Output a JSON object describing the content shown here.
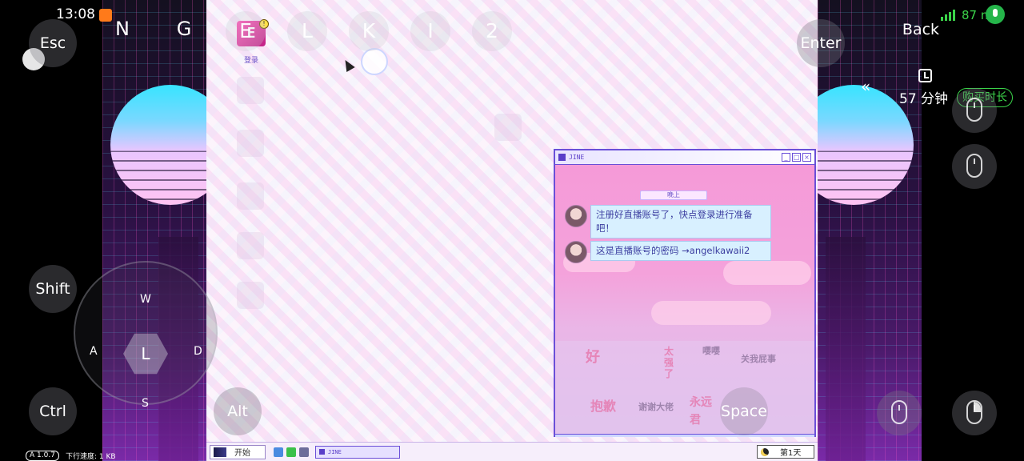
{
  "status_bar": {
    "time": "13:08",
    "battery": "87",
    "battery_suffix": "m"
  },
  "app_version": "A 1.0.7",
  "download_speed": "下行速度: 1 KB",
  "controls": {
    "esc": "Esc",
    "enter": "Enter",
    "back": "Back",
    "shift": "Shift",
    "ctrl": "Ctrl",
    "alt": "Alt",
    "space": "Space",
    "keys": [
      "N",
      "G",
      "E",
      "L",
      "K",
      "I",
      "2"
    ],
    "joystick": {
      "up": "W",
      "left": "A",
      "right": "D",
      "down": "S",
      "center": "L"
    }
  },
  "timer": {
    "minutes": "57 分钟",
    "buy_label": "购买时长"
  },
  "game": {
    "desktop_icon_label": "登录",
    "desktop_icon_glyph": "E",
    "chat_window": {
      "title": "JINE",
      "section_label": "晚上",
      "messages": [
        {
          "text": "注册好直播账号了，快点登录进行准备吧！"
        },
        {
          "text": "这是直播账号的密码 →angelkawaii2"
        }
      ],
      "stickers": [
        "好",
        "太强了",
        "嘤嘤",
        "关我屁事",
        "抱歉",
        "谢谢大佬",
        "永远",
        "君"
      ]
    },
    "taskbar": {
      "start_label": "开始",
      "task_item": "JINE",
      "day_label": "第1天"
    }
  }
}
